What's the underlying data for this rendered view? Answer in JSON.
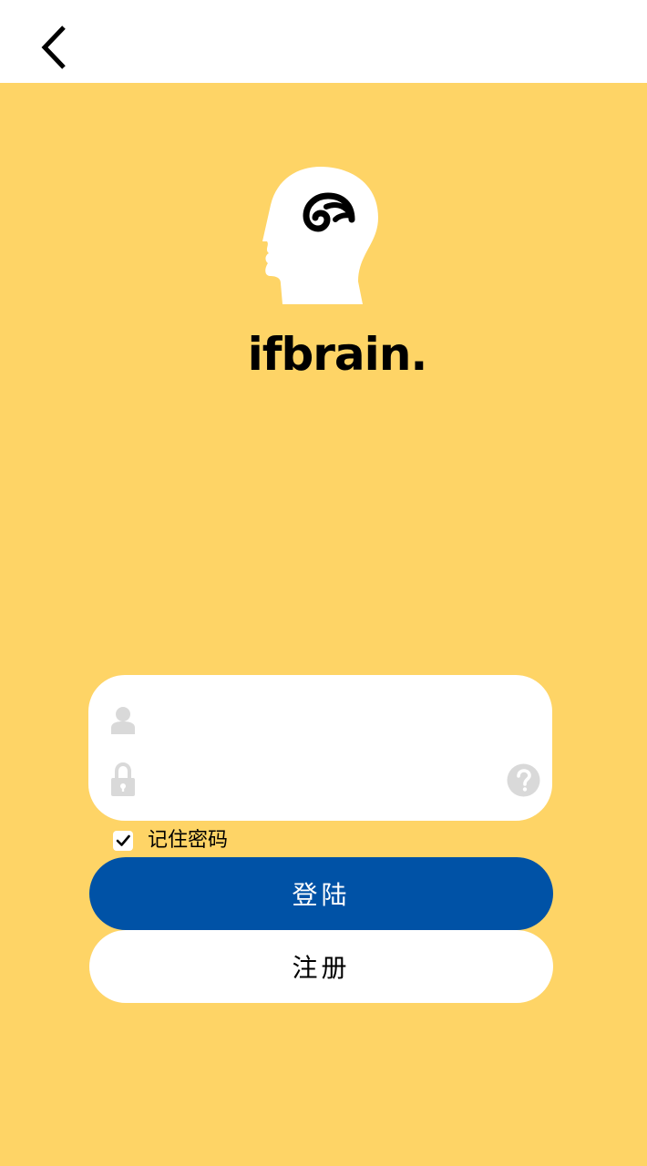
{
  "header": {
    "back_icon": "chevron-left-icon"
  },
  "brand": {
    "name": "ifbrain.",
    "logo_icon": "head-brain-logo-icon"
  },
  "login_form": {
    "username": {
      "icon": "user-icon",
      "value": "",
      "placeholder": ""
    },
    "password": {
      "icon": "lock-icon",
      "value": "",
      "placeholder": ""
    },
    "help_icon": "question-circle-icon"
  },
  "remember_password": {
    "label": "记住密码",
    "checked": true
  },
  "buttons": {
    "login_label": "登陆",
    "register_label": "注册"
  },
  "colors": {
    "background": "#fed466",
    "header_background": "#ffffff",
    "primary_button": "#0052a6",
    "secondary_button": "#ffffff",
    "icon_gray": "#d9d9d9"
  }
}
